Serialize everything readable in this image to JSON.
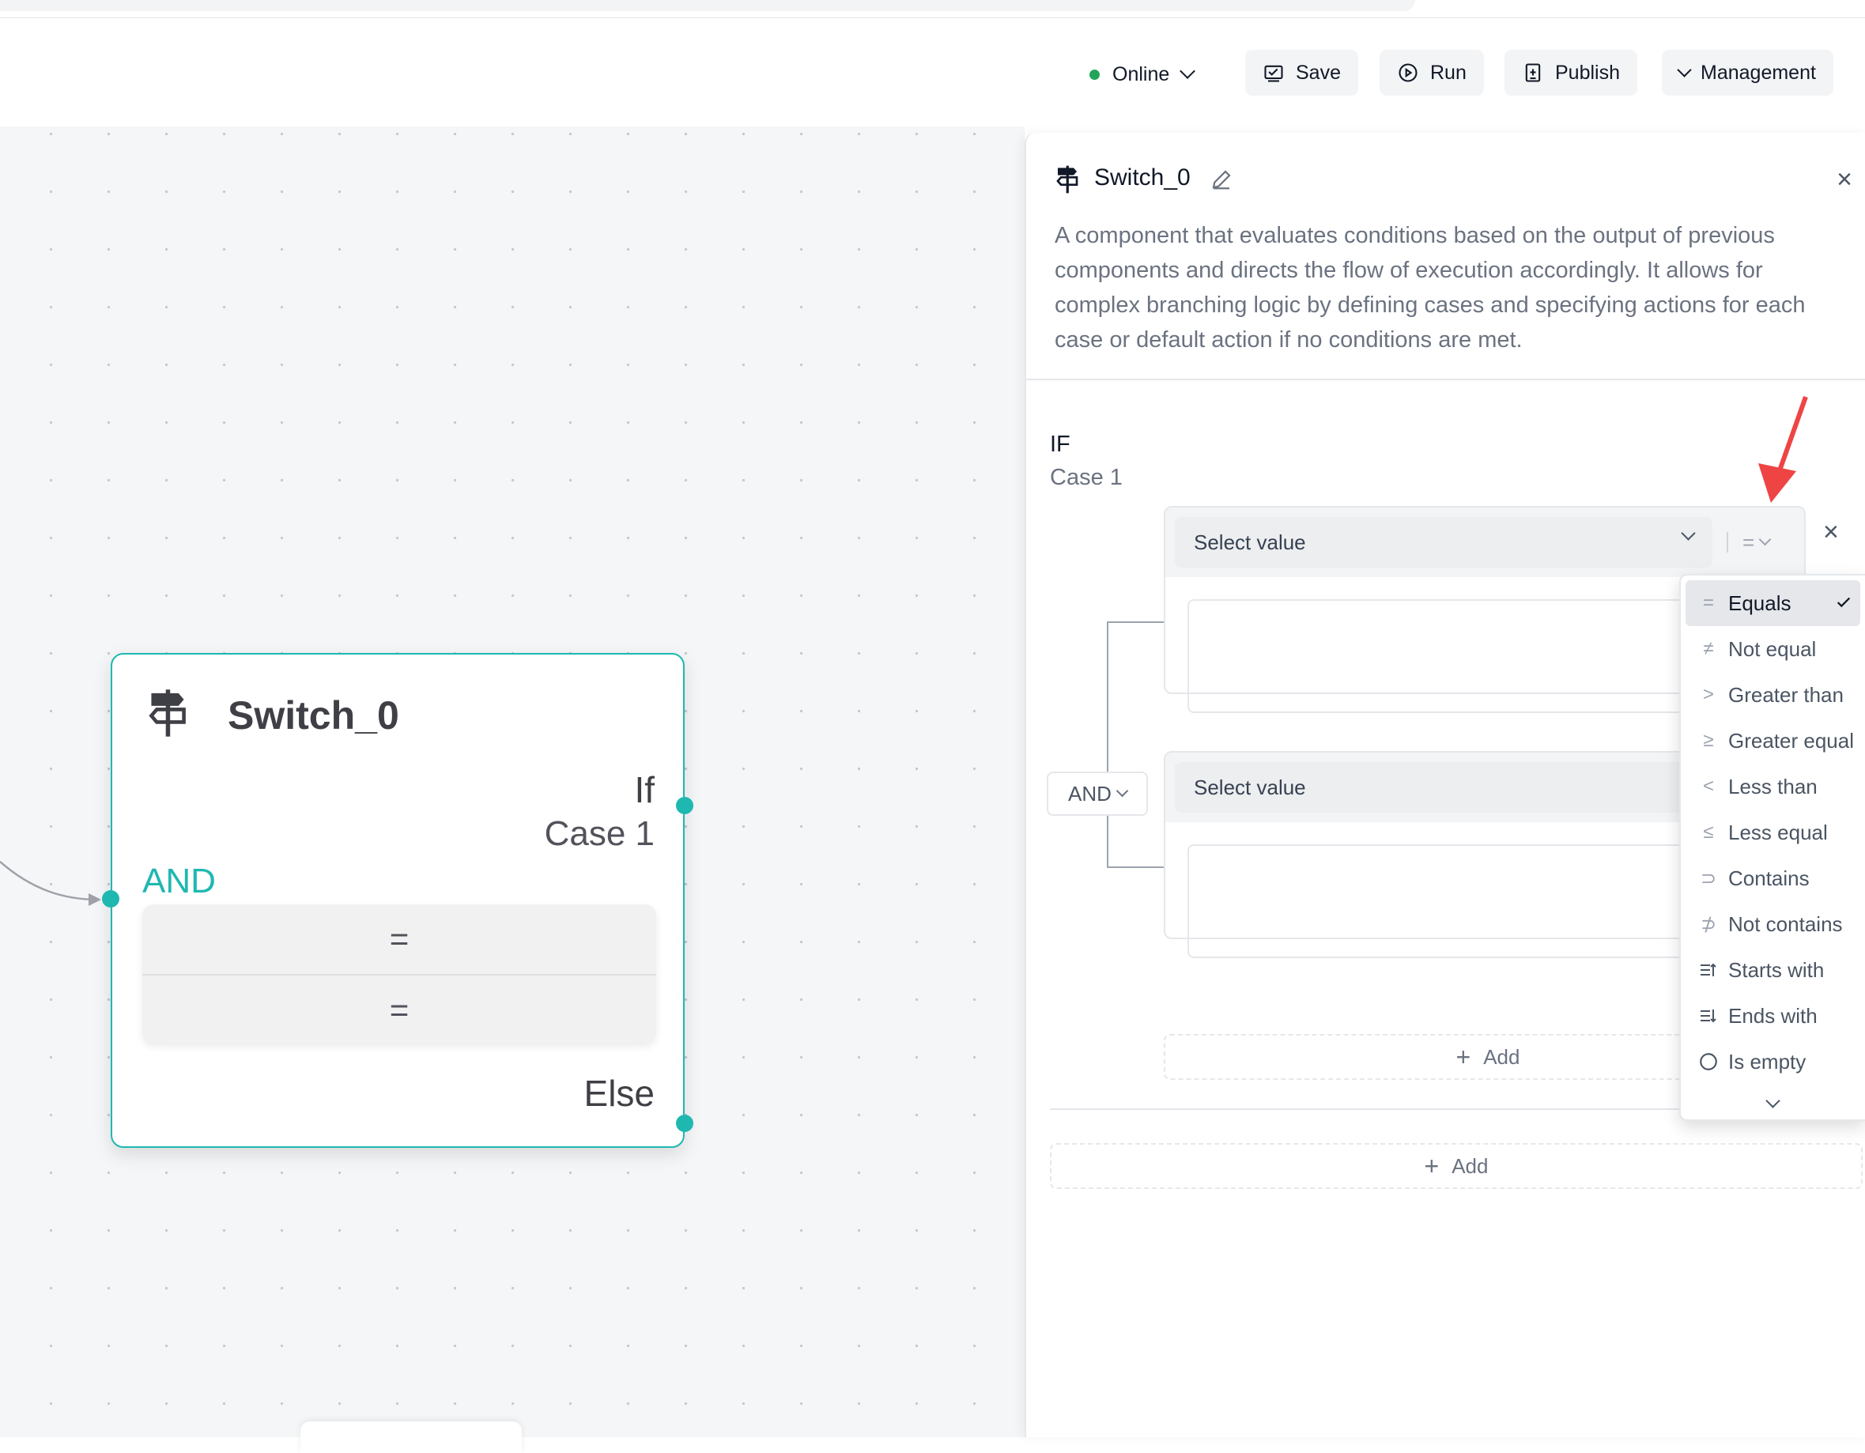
{
  "header": {
    "status": "Online",
    "buttons": {
      "save": "Save",
      "run": "Run",
      "publish": "Publish",
      "management": "Management"
    }
  },
  "node": {
    "title": "Switch_0",
    "if_label": "If",
    "case_label": "Case 1",
    "logic": "AND",
    "conditions": [
      "=",
      "="
    ],
    "else_label": "Else",
    "icon": "signpost-icon",
    "accent_color": "#1fb8b0"
  },
  "panel": {
    "title": "Switch_0",
    "description": "A component that evaluates conditions based on the output of previous components and directs the flow of execution accordingly. It allows for complex branching logic by defining cases and specifying actions for each case or default action if no conditions are met.",
    "if_label": "IF",
    "case_label": "Case 1",
    "logic_select": "AND",
    "conditions": [
      {
        "select_placeholder": "Select value",
        "operator": "="
      },
      {
        "select_placeholder": "Select value"
      }
    ],
    "add_condition_label": "Add",
    "add_case_label": "Add"
  },
  "operator_dropdown": {
    "selected": "Equals",
    "items": [
      {
        "symbol": "=",
        "label": "Equals"
      },
      {
        "symbol": "≠",
        "label": "Not equal"
      },
      {
        "symbol": ">",
        "label": "Greater than"
      },
      {
        "symbol": "≥",
        "label": "Greater equal"
      },
      {
        "symbol": "<",
        "label": "Less than"
      },
      {
        "symbol": "≤",
        "label": "Less equal"
      },
      {
        "symbol": "⊃",
        "label": "Contains"
      },
      {
        "symbol": "⊅",
        "label": "Not contains"
      },
      {
        "symbol": "starts-with-icon",
        "label": "Starts with"
      },
      {
        "symbol": "ends-with-icon",
        "label": "Ends with"
      },
      {
        "symbol": "circle-icon",
        "label": "Is empty"
      }
    ]
  },
  "colors": {
    "online": "#22a55a",
    "annotation_arrow": "#ef4444"
  }
}
